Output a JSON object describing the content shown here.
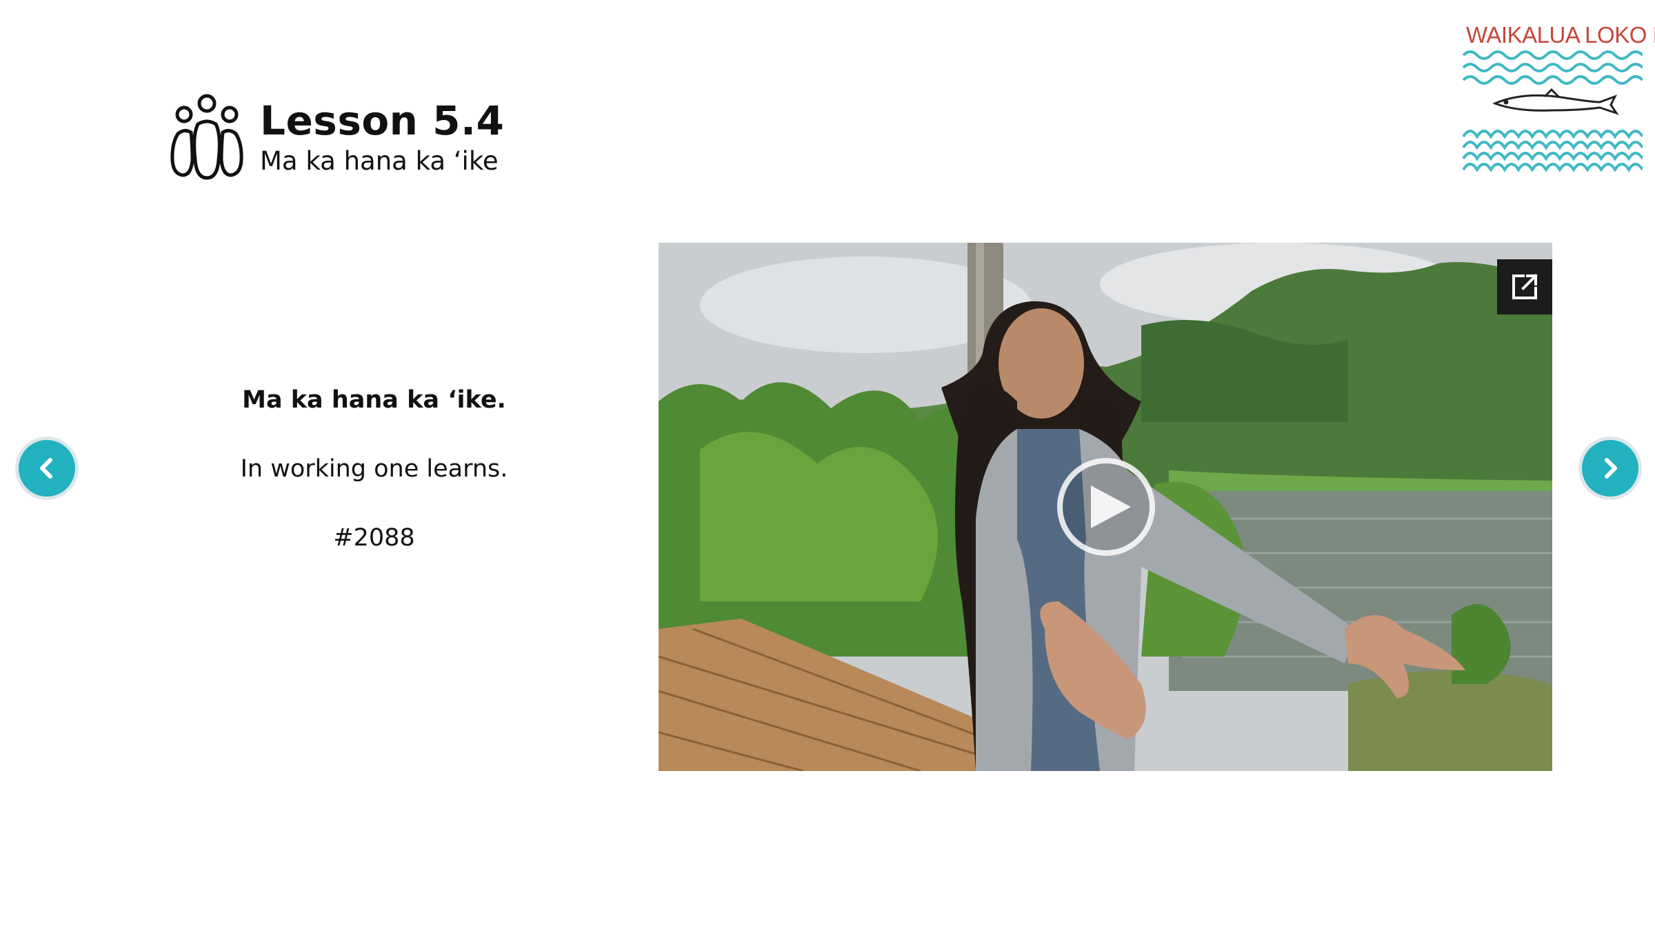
{
  "header": {
    "icon": "people-group-icon",
    "title": "Lesson 5.4",
    "subtitle": "Ma ka hana ka ‘ike"
  },
  "logo": {
    "text": "WAIKALUA LOKO I‘A",
    "colors": {
      "text": "#c8453a",
      "waves": "#3fb8c4",
      "fish": "#222222"
    }
  },
  "content": {
    "proverb": "Ma ka hana ka ‘ike.",
    "translation": "In working one learns.",
    "number": "#2088"
  },
  "navigation": {
    "prev_icon": "chevron-left-icon",
    "next_icon": "chevron-right-icon",
    "accent_color": "#22b1be"
  },
  "video": {
    "play_icon": "play-icon",
    "popout_icon": "open-in-new-icon"
  }
}
